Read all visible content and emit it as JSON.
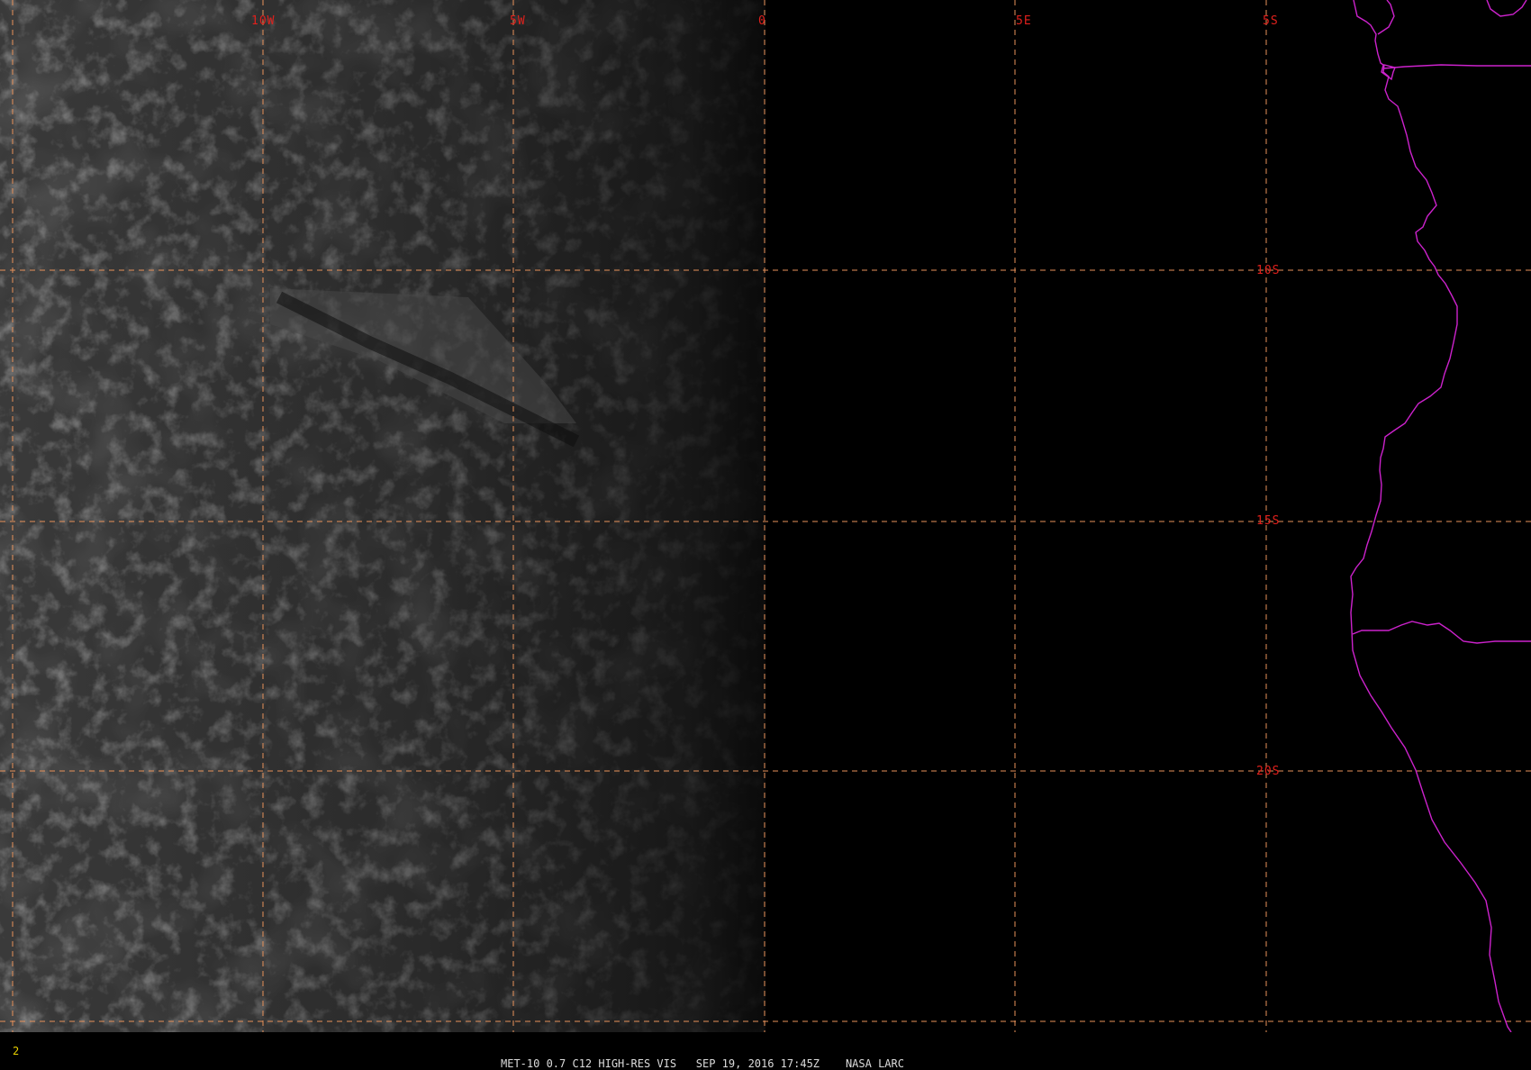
{
  "image_title": "MET-10 0.7 C12 HIGH-RES VIS",
  "frame_number": "2",
  "status": {
    "product": "MET-10 0.7 C12 HIGH-RES VIS",
    "datetime": "SEP 19, 2016 17:45Z",
    "source": "NASA LARC"
  },
  "grid": {
    "longitude_labels": [
      "10W",
      "5W",
      "0",
      "5E"
    ],
    "latitude_labels": [
      "5S",
      "10S",
      "15S",
      "20S"
    ],
    "line_color": "#e8925a",
    "label_color": "#e0201c"
  },
  "overlay": {
    "coastline_color": "#cc22cc",
    "features": [
      "coastline",
      "country-border"
    ]
  },
  "imagery": {
    "type": "visible-satellite",
    "region": "South Atlantic / SW Africa coast",
    "day_night_terminator": "0"
  }
}
